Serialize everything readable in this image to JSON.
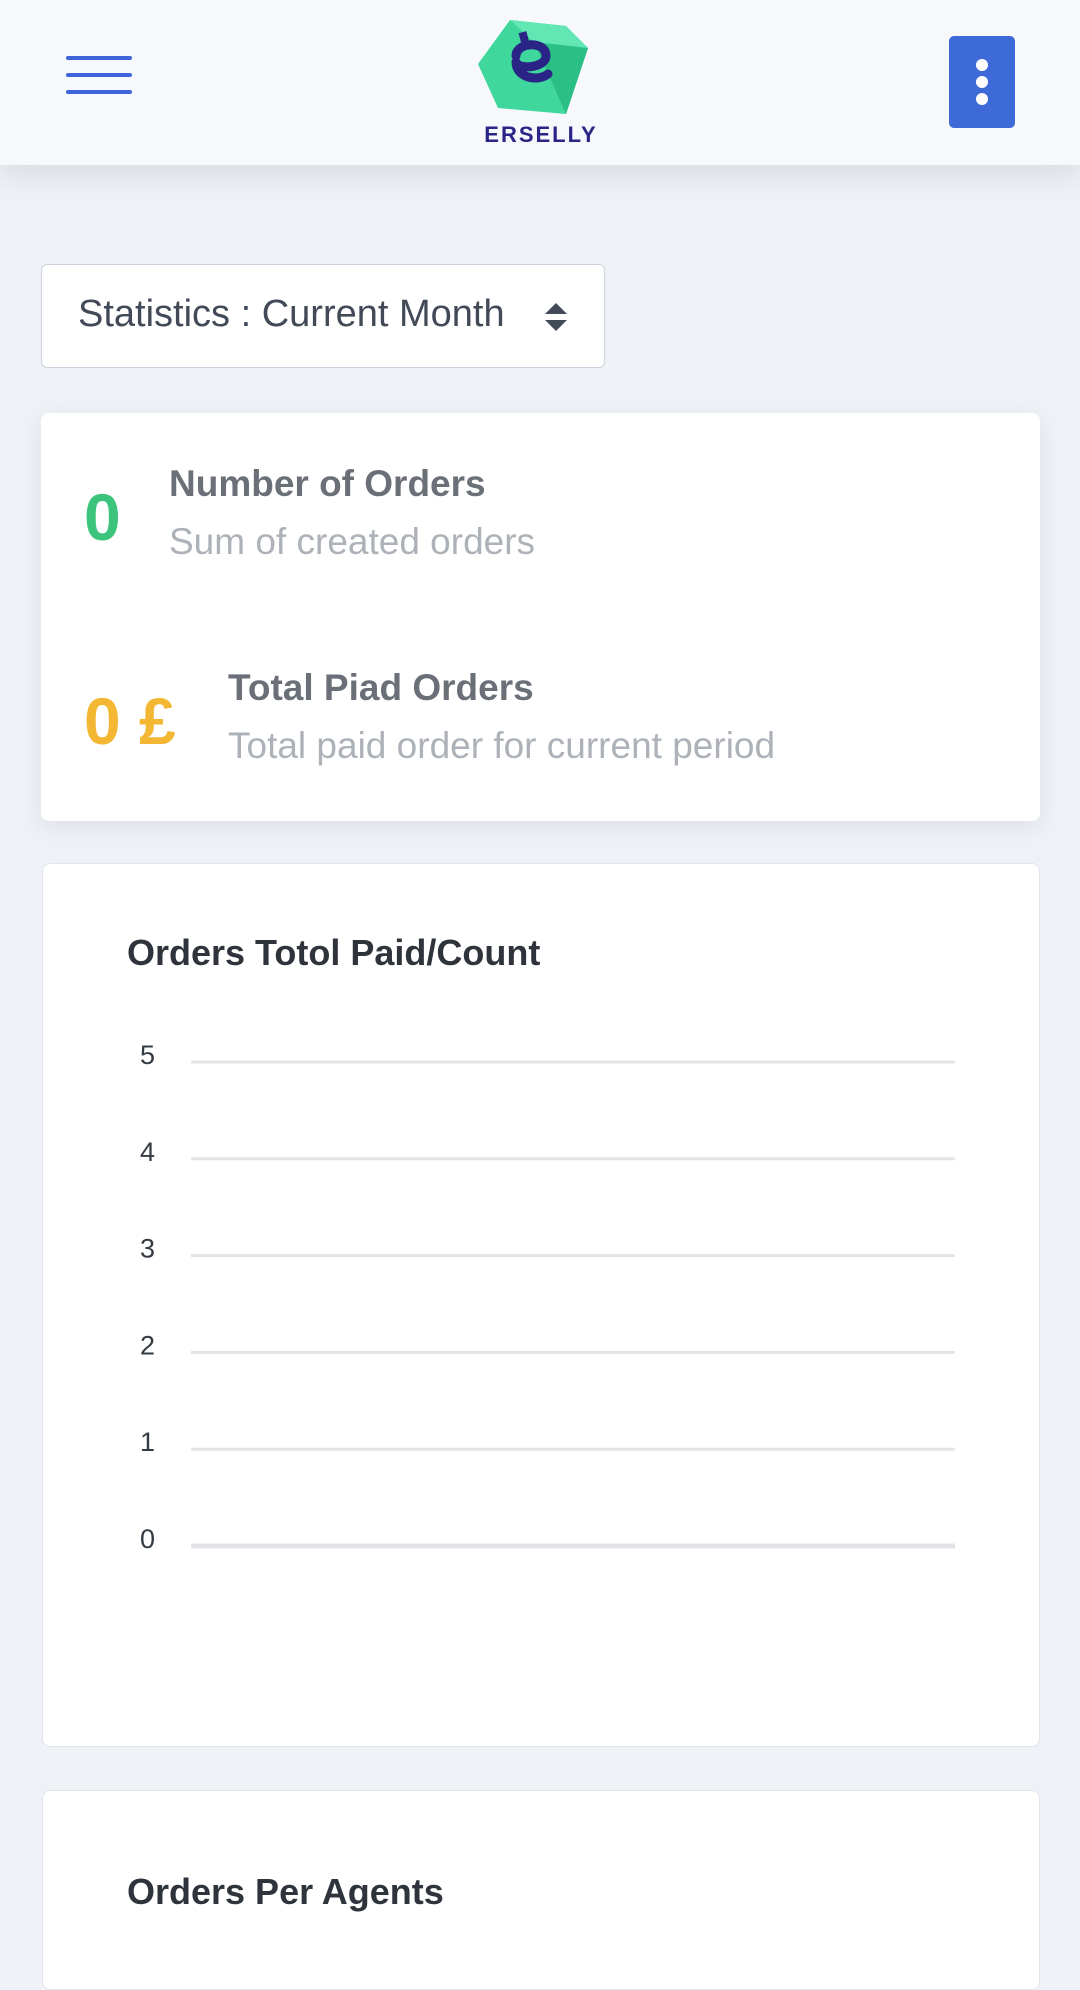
{
  "header": {
    "brand": "ERSELLY",
    "menu_icon": "hamburger-menu-icon",
    "more_icon": "vertical-ellipsis-icon",
    "accent_color": "#3e6ad8"
  },
  "filter": {
    "label": "Statistics : Current Month",
    "icon": "sort-updown-icon"
  },
  "stats": {
    "orders": {
      "value": "0",
      "title": "Number of Orders",
      "subtitle": "Sum of created orders",
      "color": "#3cc47c"
    },
    "paid": {
      "value": "0 £",
      "title": "Total Piad Orders",
      "subtitle": "Total paid order for current period",
      "color": "#f4b733"
    }
  },
  "chart_panel": {
    "title": "Orders Totol Paid/Count"
  },
  "chart_data": {
    "type": "line",
    "title": "Orders Totol Paid/Count",
    "xlabel": "",
    "ylabel": "",
    "ylim": [
      0,
      5
    ],
    "yticks": [
      "5",
      "4",
      "3",
      "2",
      "1",
      "0"
    ],
    "categories": [],
    "series": [],
    "grid": true
  },
  "agents_panel": {
    "title": "Orders Per Agents"
  }
}
